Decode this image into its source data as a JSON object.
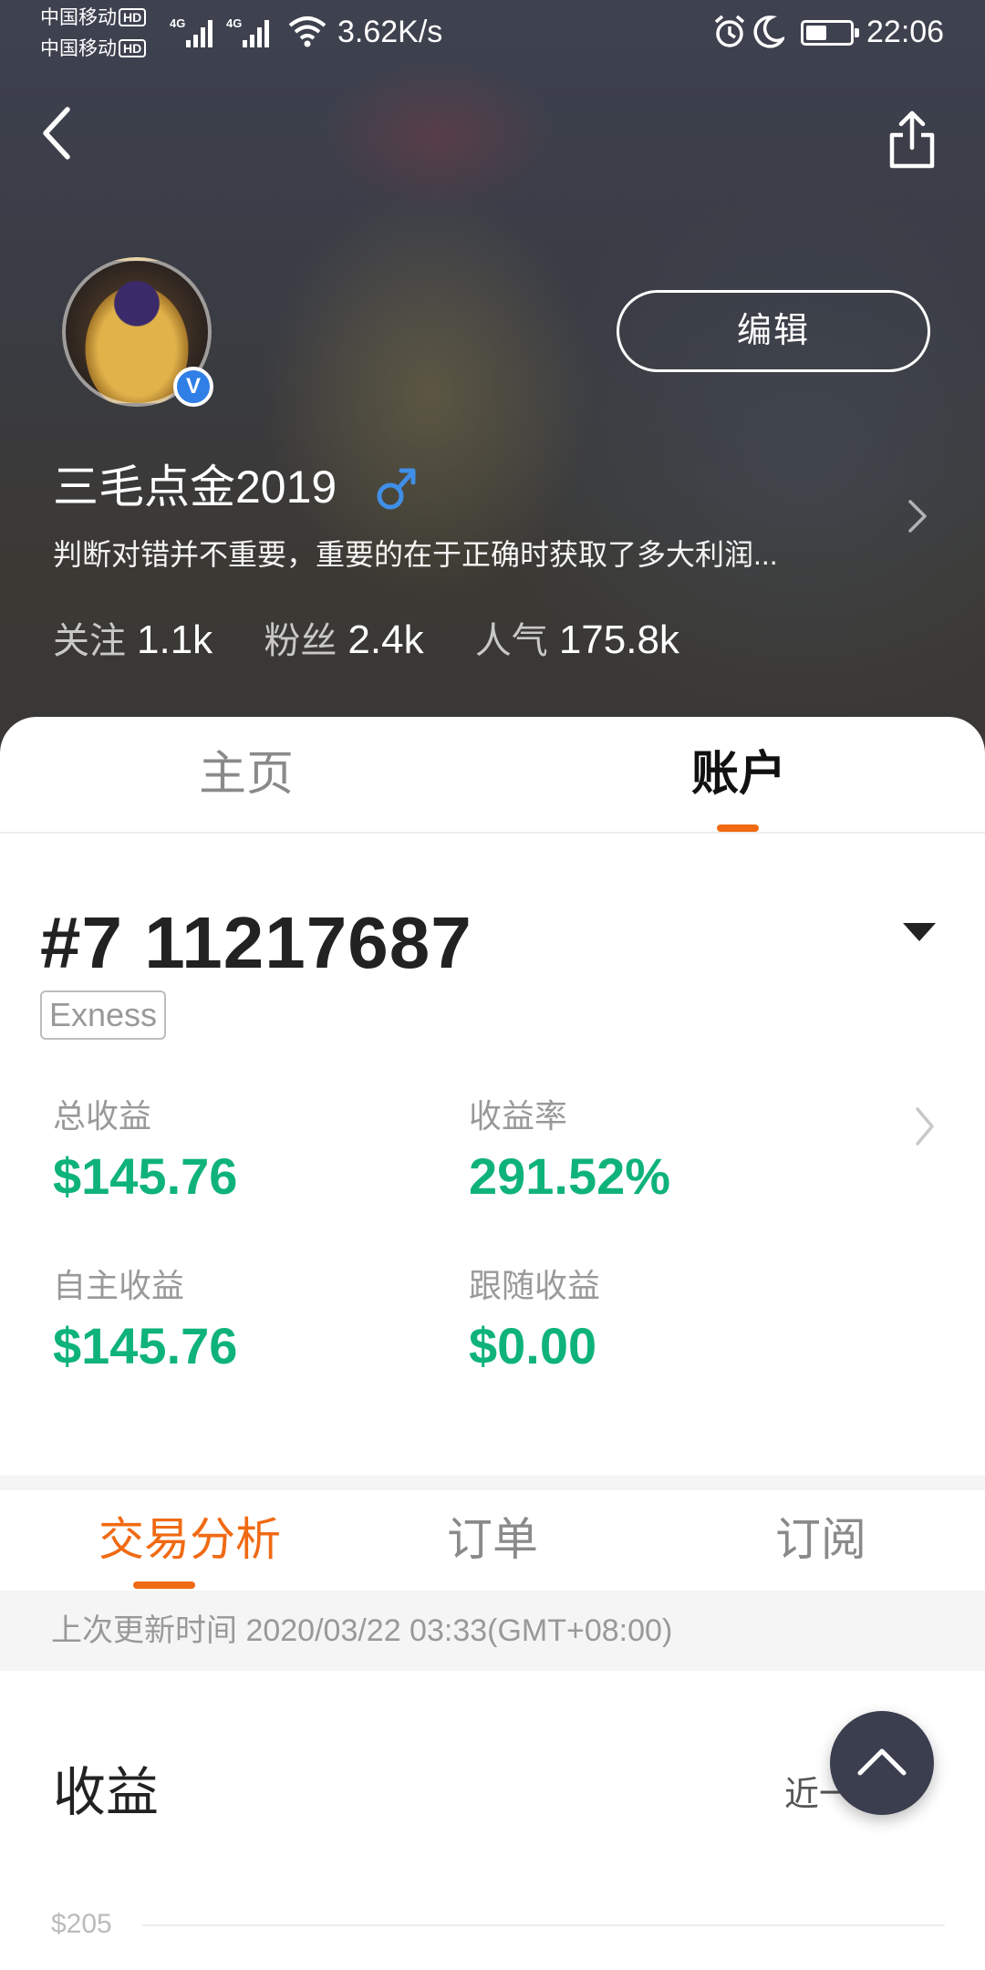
{
  "status_bar": {
    "carrier1": "中国移动",
    "carrier2": "中国移动",
    "hd": "HD",
    "network": "4G",
    "net_speed": "3.62K/s",
    "time": "22:06",
    "battery_level": 0.4
  },
  "profile": {
    "username": "三毛点金2019",
    "gender": "male",
    "verified_badge": "V",
    "bio": "判断对错并不重要，重要的在于正确时获取了多大利润...",
    "edit_label": "编辑",
    "stats": [
      {
        "label": "关注",
        "value": "1.1k"
      },
      {
        "label": "粉丝",
        "value": "2.4k"
      },
      {
        "label": "人气",
        "value": "175.8k"
      }
    ]
  },
  "main_tabs": [
    {
      "label": "主页",
      "active": false
    },
    {
      "label": "账户",
      "active": true
    }
  ],
  "account": {
    "number": "#7 11217687",
    "broker": "Exness",
    "metrics": [
      {
        "label": "总收益",
        "value": "$145.76"
      },
      {
        "label": "收益率",
        "value": "291.52%"
      },
      {
        "label": "自主收益",
        "value": "$145.76"
      },
      {
        "label": "跟随收益",
        "value": "$0.00"
      }
    ]
  },
  "sub_tabs": [
    {
      "label": "交易分析",
      "active": true
    },
    {
      "label": "订单",
      "active": false
    },
    {
      "label": "订阅",
      "active": false
    }
  ],
  "update_text": "上次更新时间 2020/03/22 03:33(GMT+08:00)",
  "earnings": {
    "title": "收益",
    "range": "近一年",
    "y_tick": "$205"
  },
  "colors": {
    "accent": "#f06a13",
    "positive": "#0fb37a",
    "verified": "#2f7fe6",
    "gender": "#3f8fe6"
  }
}
